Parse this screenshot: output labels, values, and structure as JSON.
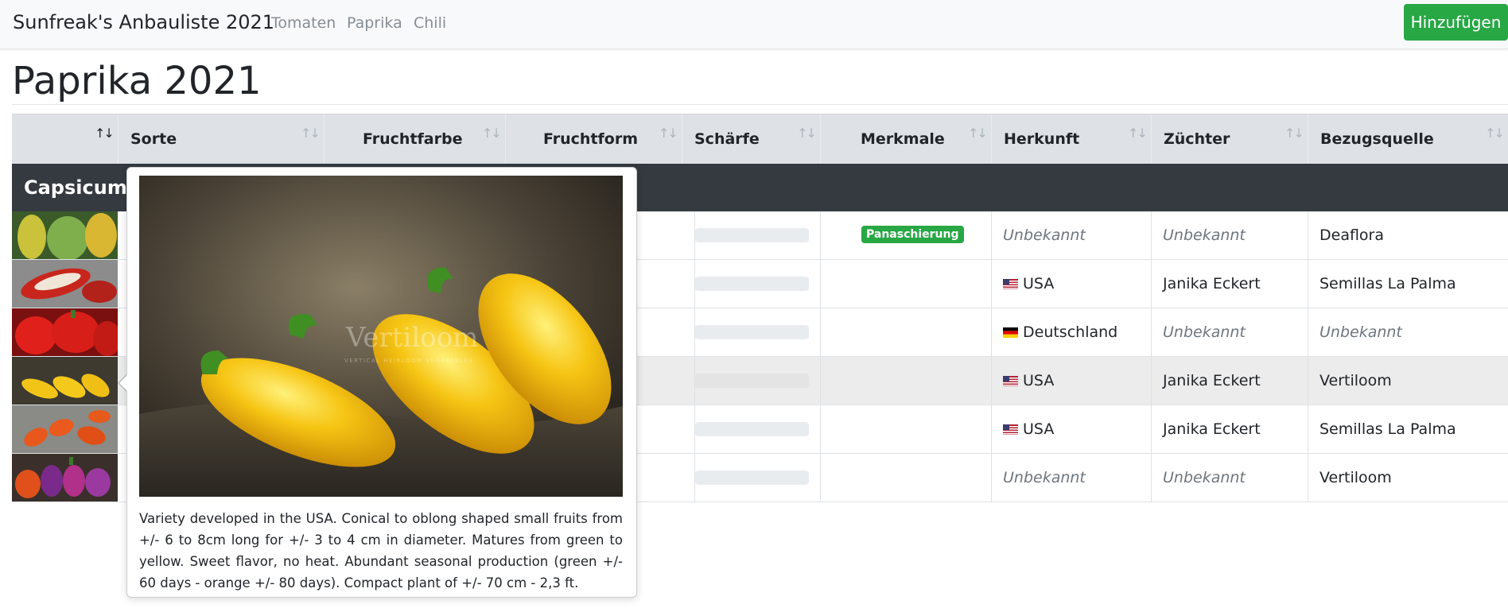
{
  "navbar": {
    "brand": "Sunfreak's Anbauliste 2021",
    "links": [
      "Tomaten",
      "Paprika",
      "Chili"
    ],
    "add_button": "Hinzufügen"
  },
  "page_title": "Paprika 2021",
  "table": {
    "columns": [
      "Sorte",
      "Fruchtfarbe",
      "Fruchtform",
      "Schärfe",
      "Merkmale",
      "Herkunft",
      "Züchter",
      "Bezugsquelle"
    ],
    "group_label": "Capsicum a",
    "rows": [
      {
        "merkmal": "Panaschierung",
        "herkunft": "Unbekannt",
        "herkunft_flag": "",
        "zuechter": "Unbekannt",
        "bezugsquelle": "Deaflora"
      },
      {
        "merkmal": "",
        "herkunft": "USA",
        "herkunft_flag": "us-flag-icon",
        "zuechter": "Janika Eckert",
        "bezugsquelle": "Semillas La Palma"
      },
      {
        "merkmal": "",
        "herkunft": "Deutschland",
        "herkunft_flag": "de-flag-icon",
        "zuechter": "Unbekannt",
        "bezugsquelle": "Unbekannt"
      },
      {
        "merkmal": "",
        "herkunft": "USA",
        "herkunft_flag": "us-flag-icon",
        "zuechter": "Janika Eckert",
        "bezugsquelle": "Vertiloom"
      },
      {
        "merkmal": "",
        "herkunft": "USA",
        "herkunft_flag": "us-flag-icon",
        "zuechter": "Janika Eckert",
        "bezugsquelle": "Semillas La Palma"
      },
      {
        "merkmal": "",
        "herkunft": "Unbekannt",
        "herkunft_flag": "",
        "zuechter": "Unbekannt",
        "bezugsquelle": "Vertiloom"
      }
    ]
  },
  "popover": {
    "description": "Variety developed in the USA. Conical to oblong shaped small fruits from +/- 6 to 8cm long for +/- 3 to 4 cm in diameter. Matures from green to yellow. Sweet flavor, no heat. Abundant seasonal production (green +/- 60 days - orange +/- 80 days). Compact plant of +/- 70 cm - 2,3 ft.",
    "watermark": "Vertiloom",
    "watermark_sub": "VERTICAL HEIRLOOM VEGETABLES"
  },
  "colors": {
    "accent_green": "#28a745",
    "group_row_bg": "#343a40",
    "header_bg": "#dee2e6"
  }
}
